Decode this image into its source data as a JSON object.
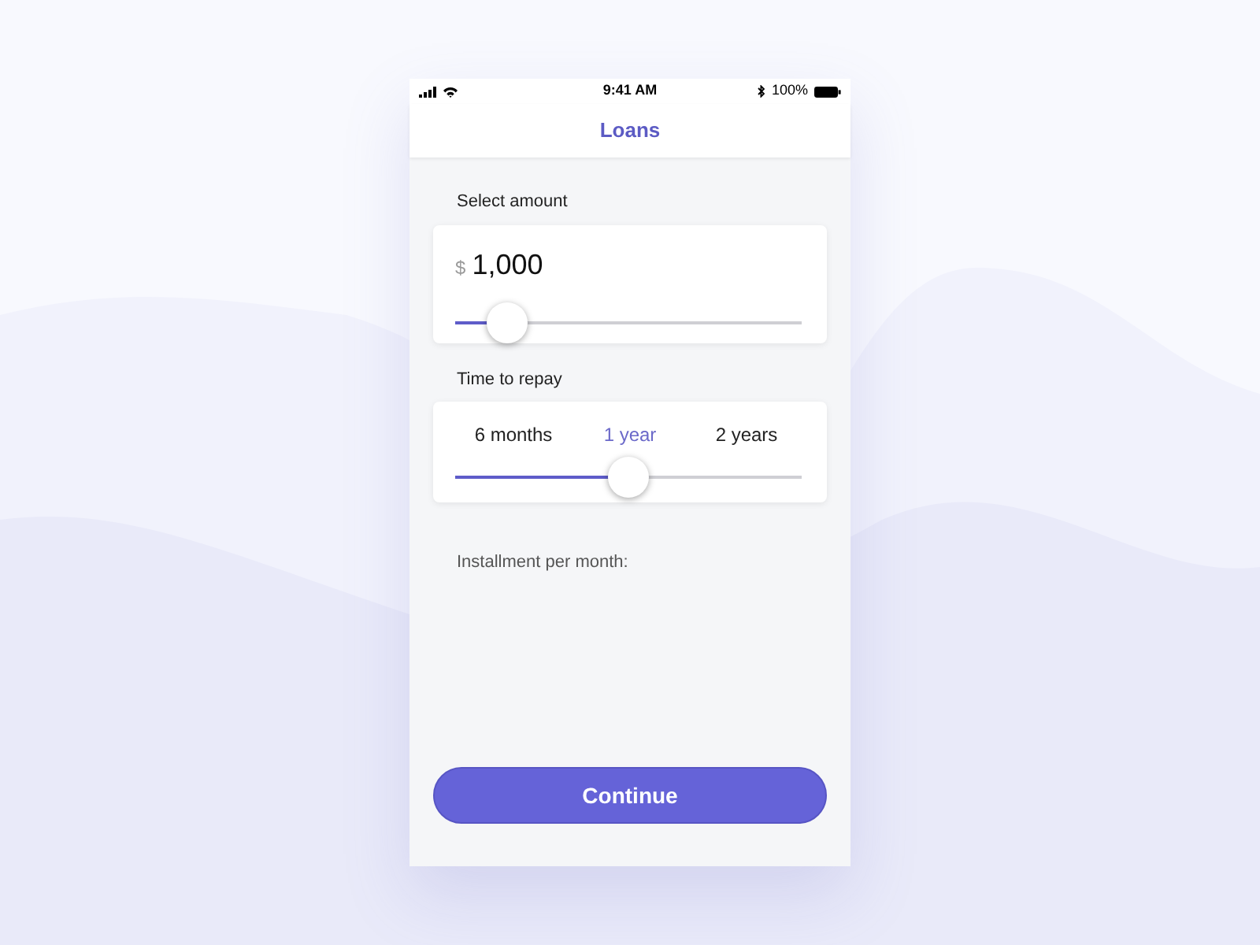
{
  "status_bar": {
    "time": "9:41 AM",
    "battery": "100%"
  },
  "header": {
    "title": "Loans"
  },
  "amount": {
    "label": "Select amount",
    "currency": "$",
    "value": "1,000",
    "level": 0.15
  },
  "repay": {
    "label": "Time to repay",
    "options": [
      {
        "label": "6 months",
        "selected": false
      },
      {
        "label": "1 year",
        "selected": true
      },
      {
        "label": "2 years",
        "selected": false
      }
    ],
    "level": 0.5
  },
  "installment": {
    "label": "Installment per month:"
  },
  "button": {
    "label": "Continue"
  }
}
